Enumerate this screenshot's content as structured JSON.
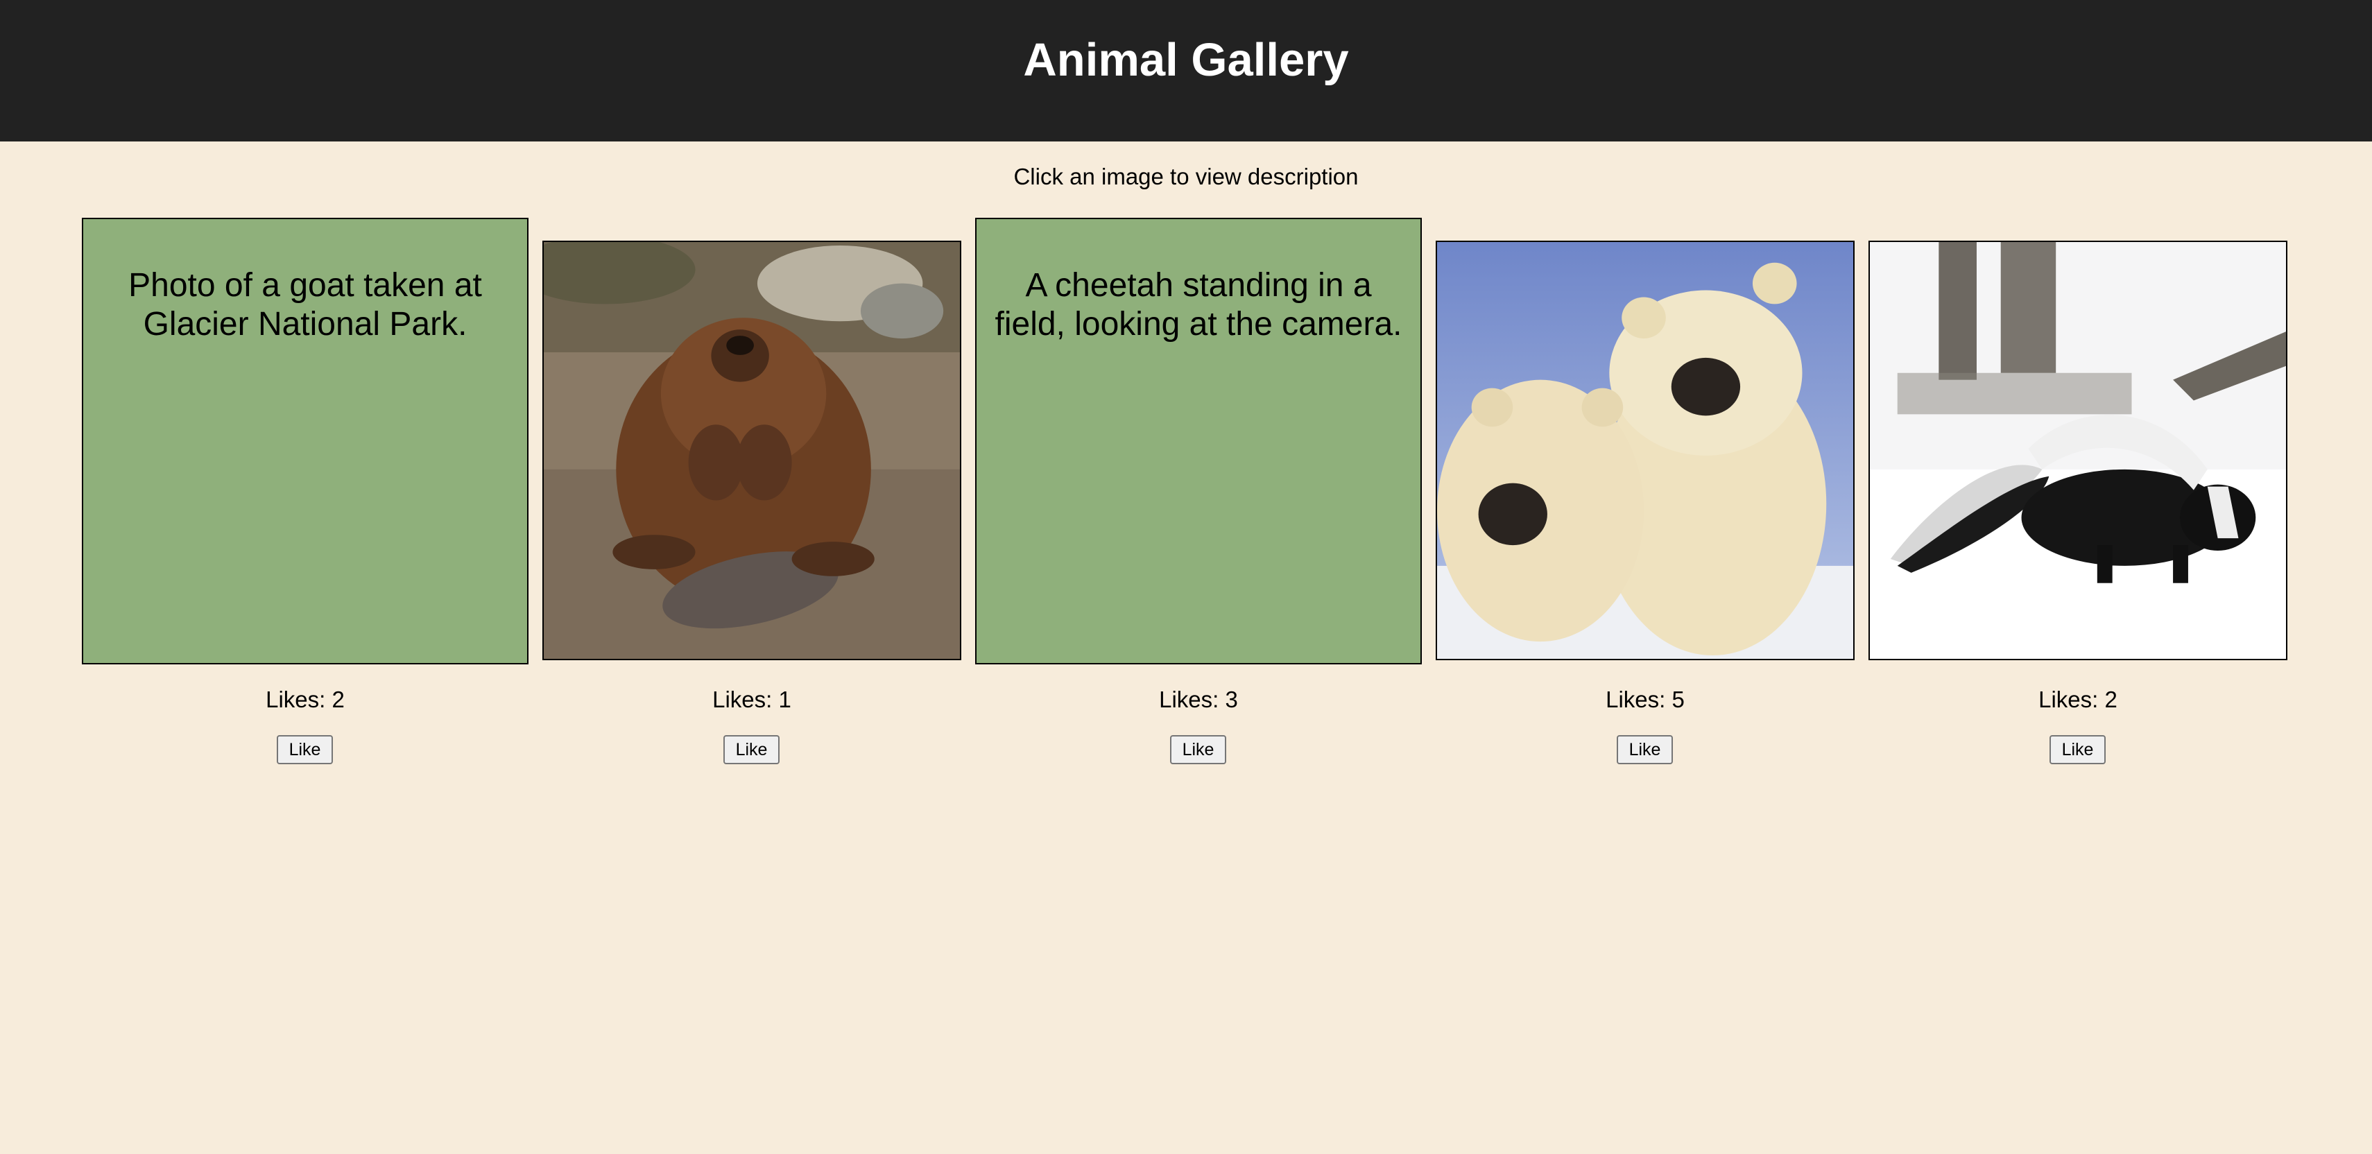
{
  "header": {
    "title": "Animal Gallery"
  },
  "subtitle": "Click an image to view description",
  "gallery": [
    {
      "animal": "goat",
      "showing": "description",
      "description": "Photo of a goat taken at Glacier National Park.",
      "likes_text": "Likes: 2",
      "button_label": "Like"
    },
    {
      "animal": "beaver",
      "showing": "image",
      "likes_text": "Likes: 1",
      "button_label": "Like"
    },
    {
      "animal": "cheetah",
      "showing": "description",
      "description": "A cheetah standing in a field, looking at the camera.",
      "likes_text": "Likes: 3",
      "button_label": "Like"
    },
    {
      "animal": "polar-bears",
      "showing": "image",
      "likes_text": "Likes: 5",
      "button_label": "Like"
    },
    {
      "animal": "skunk",
      "showing": "image",
      "likes_text": "Likes: 2",
      "button_label": "Like"
    }
  ],
  "colors": {
    "header_bg": "#222222",
    "page_bg": "#f7ecdb",
    "description_bg": "#8fb07b"
  }
}
